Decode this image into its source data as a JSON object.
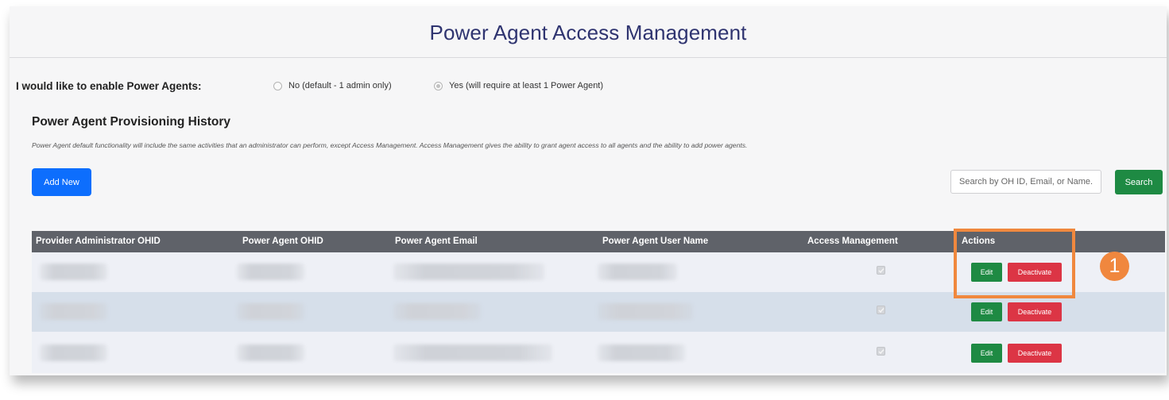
{
  "page": {
    "title": "Power Agent Access Management"
  },
  "enable": {
    "label": "I would like to enable Power Agents:",
    "options": [
      {
        "label": "No (default - 1 admin only)",
        "checked": false
      },
      {
        "label": "Yes (will require at least 1 Power Agent)",
        "checked": true
      }
    ]
  },
  "history": {
    "title": "Power Agent Provisioning History",
    "description": "Power Agent default functionality will include the same activities that an administrator can perform, except Access Management. Access Management gives the ability to grant agent access to all agents and the ability to add power agents.",
    "add_button": "Add New",
    "search_placeholder": "Search by OH ID, Email, or Name...",
    "search_button": "Search"
  },
  "table": {
    "columns": [
      "Provider Administrator OHID",
      "Power Agent OHID",
      "Power Agent Email",
      "Power Agent User Name",
      "Access Management",
      "Actions"
    ],
    "rows": [
      {
        "access_management": true,
        "edit_label": "Edit",
        "deactivate_label": "Deactivate"
      },
      {
        "access_management": true,
        "edit_label": "Edit",
        "deactivate_label": "Deactivate"
      },
      {
        "access_management": true,
        "edit_label": "Edit",
        "deactivate_label": "Deactivate"
      }
    ]
  },
  "callout": {
    "step": "1"
  },
  "colors": {
    "title": "#2f3470",
    "primary": "#0d6efd",
    "success": "#1e8a43",
    "danger": "#dc3545",
    "header": "#5f6269",
    "callout": "#f0883e"
  }
}
